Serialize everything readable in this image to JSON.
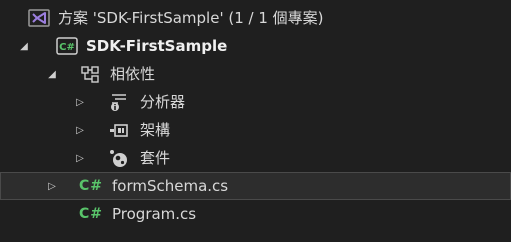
{
  "solution": {
    "label": "方案 'SDK-FirstSample' (1 / 1 個專案)",
    "icon": "visual-studio-solution-icon"
  },
  "project": {
    "label": "SDK-FirstSample",
    "icon": "csharp-project-icon",
    "expanded": true
  },
  "dependencies": {
    "label": "相依性",
    "icon": "dependencies-icon",
    "expanded": true,
    "children": [
      {
        "label": "分析器",
        "icon": "analyzer-icon",
        "expanded": false
      },
      {
        "label": "架構",
        "icon": "framework-icon",
        "expanded": false
      },
      {
        "label": "套件",
        "icon": "package-icon",
        "expanded": false
      }
    ]
  },
  "files": [
    {
      "label": "formSchema.cs",
      "icon_text": "C#",
      "expandable": true,
      "selected": true
    },
    {
      "label": "Program.cs",
      "icon_text": "C#",
      "expandable": false,
      "selected": false
    }
  ],
  "colors": {
    "background": "#1f1f1f",
    "selection": "#2d2d2d",
    "csharp_green": "#59c46a",
    "solution_purple": "#9b7ede"
  }
}
